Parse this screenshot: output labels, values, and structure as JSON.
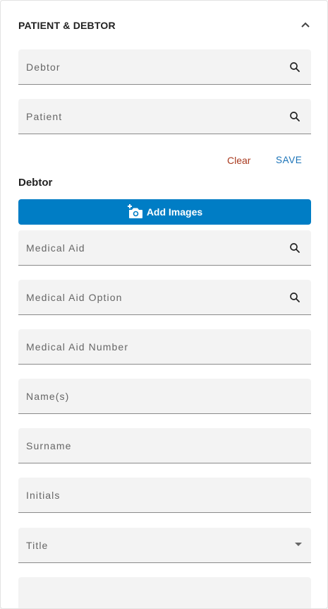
{
  "section": {
    "title": "PATIENT & DEBTOR"
  },
  "search_fields": [
    {
      "label": "Debtor",
      "icon": "search-icon"
    },
    {
      "label": "Patient",
      "icon": "search-icon"
    }
  ],
  "actions": {
    "clear_label": "Clear",
    "save_label": "SAVE"
  },
  "debtor": {
    "heading": "Debtor",
    "add_images_label": "Add Images",
    "fields": [
      {
        "label": "Medical Aid",
        "icon": "search-icon"
      },
      {
        "label": "Medical Aid Option",
        "icon": "search-icon"
      },
      {
        "label": "Medical Aid Number"
      },
      {
        "label": "Name(s)"
      },
      {
        "label": "Surname"
      },
      {
        "label": "Initials"
      },
      {
        "label": "Title",
        "icon": "chevron-down-icon"
      },
      {
        "label": ""
      }
    ]
  },
  "colors": {
    "accent": "#007dc5",
    "save": "#1a73b8",
    "clear": "#a93a1f",
    "field_bg": "#f3f3f3"
  }
}
